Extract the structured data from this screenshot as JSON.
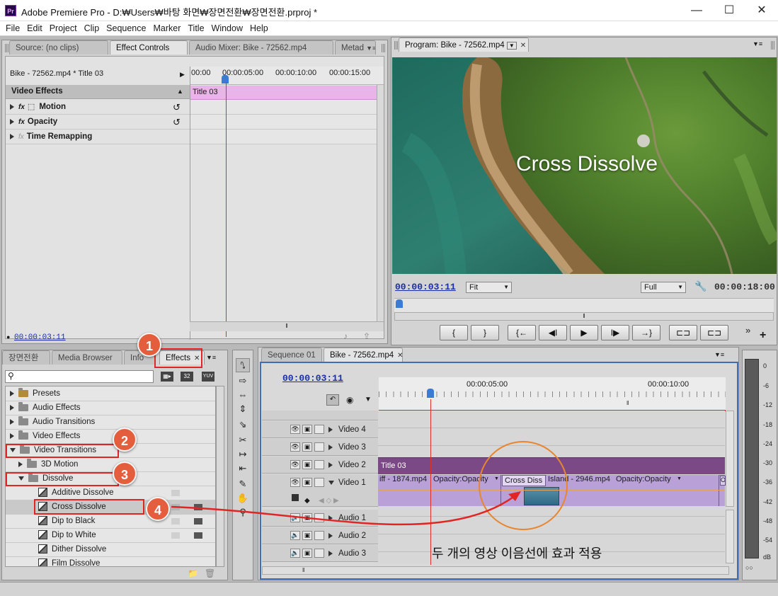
{
  "window": {
    "app": "Adobe Premiere Pro",
    "title": "Adobe Premiere Pro - D:₩Users₩바탕 화면₩장면전환₩장면전환.prproj *",
    "icon_text": "Pr"
  },
  "menu": [
    "File",
    "Edit",
    "Project",
    "Clip",
    "Sequence",
    "Marker",
    "Title",
    "Window",
    "Help"
  ],
  "source_panel": {
    "tabs": [
      "Source: (no clips)",
      "Effect Controls",
      "Audio Mixer: Bike - 72562.mp4",
      "Metad"
    ],
    "clip_label": "Bike - 72562.mp4 * Title 03",
    "ruler": [
      "00:00",
      "00:00:05:00",
      "00:00:10:00",
      "00:00:15:00"
    ],
    "title_bar_clip": "Title 03",
    "section": "Video Effects",
    "effects": [
      {
        "name": "Motion",
        "fx": "fx"
      },
      {
        "name": "Opacity",
        "fx": "fx"
      },
      {
        "name": "Time Remapping",
        "fx": "fx"
      }
    ],
    "timecode": "00:00:03:11"
  },
  "program_panel": {
    "tab": "Program: Bike - 72562.mp4",
    "overlay_text": "Cross Dissolve",
    "timecode_current": "00:00:03:11",
    "zoom": "Fit",
    "quality": "Full",
    "timecode_duration": "00:00:18:00",
    "transport": [
      "{",
      "}",
      "{←",
      "◀I",
      "▶",
      "I▶",
      "→}",
      "⊏⊐",
      "⊏⊐"
    ]
  },
  "effects_panel": {
    "tabs": [
      "장면전환",
      "Media Browser",
      "Info",
      "Effects"
    ],
    "search_placeholder": "",
    "badges": [
      "32",
      "YUV"
    ],
    "tree": [
      {
        "label": "Presets",
        "level": 0,
        "expanded": false,
        "folder": true,
        "star": true
      },
      {
        "label": "Audio Effects",
        "level": 0,
        "expanded": false,
        "folder": true
      },
      {
        "label": "Audio Transitions",
        "level": 0,
        "expanded": false,
        "folder": true
      },
      {
        "label": "Video Effects",
        "level": 0,
        "expanded": false,
        "folder": true
      },
      {
        "label": "Video Transitions",
        "level": 0,
        "expanded": true,
        "folder": true
      },
      {
        "label": "3D Motion",
        "level": 1,
        "expanded": false,
        "folder": true
      },
      {
        "label": "Dissolve",
        "level": 1,
        "expanded": true,
        "folder": true
      },
      {
        "label": "Additive Dissolve",
        "level": 2,
        "folder": false
      },
      {
        "label": "Cross Dissolve",
        "level": 2,
        "folder": false,
        "selected": true
      },
      {
        "label": "Dip to Black",
        "level": 2,
        "folder": false
      },
      {
        "label": "Dip to White",
        "level": 2,
        "folder": false
      },
      {
        "label": "Dither Dissolve",
        "level": 2,
        "folder": false
      },
      {
        "label": "Film Dissolve",
        "level": 2,
        "folder": false
      }
    ]
  },
  "timeline": {
    "tabs": [
      "Sequence 01",
      "Bike - 72562.mp4"
    ],
    "timecode": "00:00:03:11",
    "ruler": [
      "00:00:05:00",
      "00:00:10:00"
    ],
    "tracks": [
      "Video 4",
      "Video 3",
      "Video 2",
      "Video 1",
      "Audio 1",
      "Audio 2",
      "Audio 3"
    ],
    "title_clip": "Title 03",
    "clip_a": "iff - 1874.mp4",
    "clip_a_opacity": "Opacity:Opacity",
    "transition": "Cross Diss",
    "clip_b": "Island - 2946.mp4",
    "clip_b_opacity": "Opacity:Opacity",
    "clip_c": "O"
  },
  "annotation": {
    "text": "두 개의 영상 이음선에 효과 적용",
    "steps": [
      "1",
      "2",
      "3",
      "4"
    ],
    "color": "#e02525"
  },
  "audio_meter": {
    "labels": [
      "0",
      "-6",
      "-12",
      "-18",
      "-24",
      "-30",
      "-36",
      "-42",
      "-48",
      "-54",
      "dB"
    ]
  },
  "colors": {
    "title_clip": "#7b4a86",
    "clip_purple": "#b9a1d8",
    "playhead": "#d9302a",
    "timecode_blue": "#1b2ea8",
    "callout": "#e45d3c"
  }
}
